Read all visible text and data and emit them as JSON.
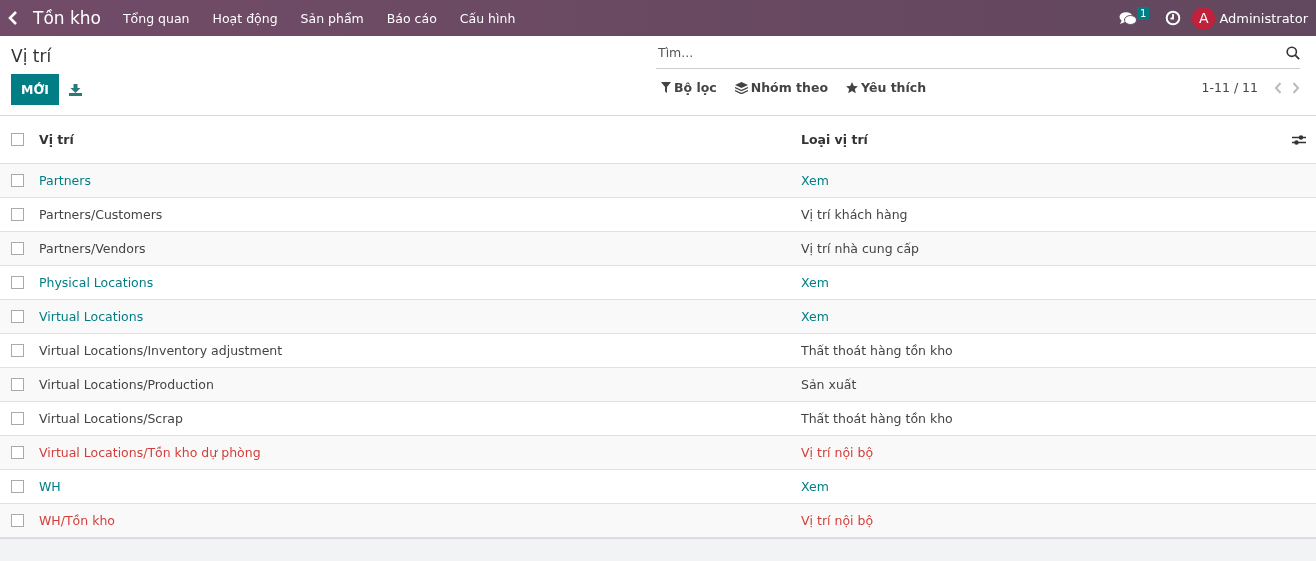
{
  "navbar": {
    "app": "Tồn kho",
    "menus": [
      "Tổng quan",
      "Hoạt động",
      "Sản phẩm",
      "Báo cáo",
      "Cấu hình"
    ],
    "message_count": "1",
    "user_initial": "A",
    "user": "Administrator"
  },
  "page": {
    "title": "Vị trí",
    "new_button": "MỚI"
  },
  "search": {
    "placeholder": "Tìm..."
  },
  "filters": [
    {
      "kind": "filter",
      "label": "Bộ lọc"
    },
    {
      "kind": "group",
      "label": "Nhóm theo"
    },
    {
      "kind": "favorite",
      "label": "Yêu thích"
    }
  ],
  "pager": "1-11 / 11",
  "table": {
    "select_all_checked": false,
    "columns": [
      "Vị trí",
      "Loại vị trí"
    ],
    "rows": [
      {
        "name": "Partners",
        "type": "Xem",
        "kind": "view",
        "checked": false
      },
      {
        "name": "Partners/Customers",
        "type": "Vị trí khách hàng",
        "kind": "other",
        "checked": false
      },
      {
        "name": "Partners/Vendors",
        "type": "Vị trí nhà cung cấp",
        "kind": "other",
        "checked": false
      },
      {
        "name": "Physical Locations",
        "type": "Xem",
        "kind": "view",
        "checked": false
      },
      {
        "name": "Virtual Locations",
        "type": "Xem",
        "kind": "view",
        "checked": false
      },
      {
        "name": "Virtual Locations/Inventory adjustment",
        "type": "Thất thoát hàng tồn kho",
        "kind": "other",
        "checked": false
      },
      {
        "name": "Virtual Locations/Production",
        "type": "Sản xuất",
        "kind": "other",
        "checked": false
      },
      {
        "name": "Virtual Locations/Scrap",
        "type": "Thất thoát hàng tồn kho",
        "kind": "other",
        "checked": false
      },
      {
        "name": "Virtual Locations/Tồn kho dự phòng",
        "type": "Vị trí nội bộ",
        "kind": "internal",
        "checked": false
      },
      {
        "name": "WH",
        "type": "Xem",
        "kind": "view",
        "checked": false
      },
      {
        "name": "WH/Tồn kho",
        "type": "Vị trí nội bộ",
        "kind": "internal",
        "checked": false
      }
    ]
  }
}
